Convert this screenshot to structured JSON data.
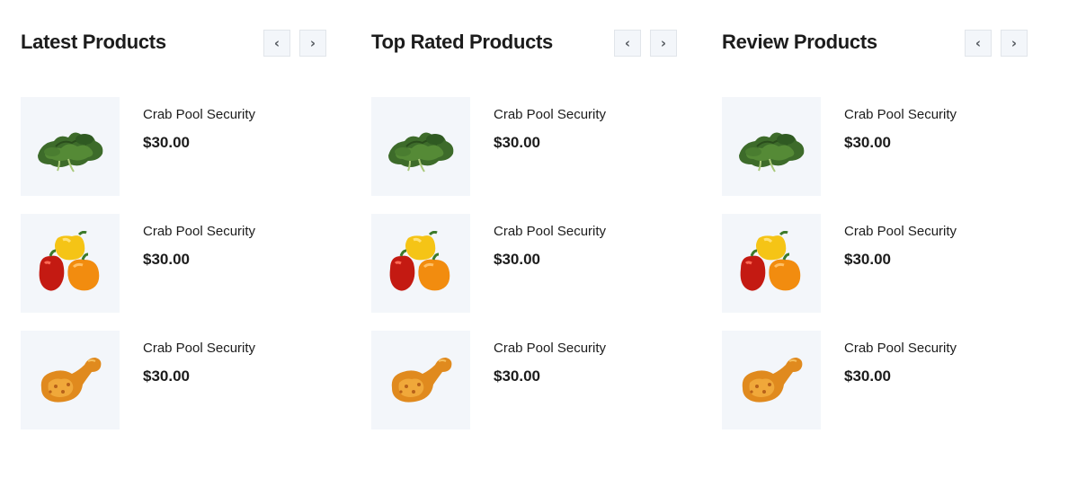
{
  "sections": [
    {
      "title": "Latest Products",
      "prev_icon": "chevron-left-icon",
      "next_icon": "chevron-right-icon",
      "prev_glyph": "‹",
      "next_glyph": "›",
      "items": [
        {
          "name": "Crab Pool Security",
          "price": "$30.00",
          "image": "leafy-greens"
        },
        {
          "name": "Crab Pool Security",
          "price": "$30.00",
          "image": "bell-peppers"
        },
        {
          "name": "Crab Pool Security",
          "price": "$30.00",
          "image": "fried-chicken"
        }
      ]
    },
    {
      "title": "Top Rated Products",
      "prev_icon": "chevron-left-icon",
      "next_icon": "chevron-right-icon",
      "prev_glyph": "‹",
      "next_glyph": "›",
      "items": [
        {
          "name": "Crab Pool Security",
          "price": "$30.00",
          "image": "leafy-greens"
        },
        {
          "name": "Crab Pool Security",
          "price": "$30.00",
          "image": "bell-peppers"
        },
        {
          "name": "Crab Pool Security",
          "price": "$30.00",
          "image": "fried-chicken"
        }
      ]
    },
    {
      "title": "Review Products",
      "prev_icon": "chevron-left-icon",
      "next_icon": "chevron-right-icon",
      "prev_glyph": "‹",
      "next_glyph": "›",
      "items": [
        {
          "name": "Crab Pool Security",
          "price": "$30.00",
          "image": "leafy-greens"
        },
        {
          "name": "Crab Pool Security",
          "price": "$30.00",
          "image": "bell-peppers"
        },
        {
          "name": "Crab Pool Security",
          "price": "$30.00",
          "image": "fried-chicken"
        }
      ]
    }
  ],
  "colors": {
    "text": "#1c1c1c",
    "thumb_bg": "#f3f6fa",
    "nav_bg": "#f3f6fa",
    "nav_border": "#e1e5ea"
  }
}
